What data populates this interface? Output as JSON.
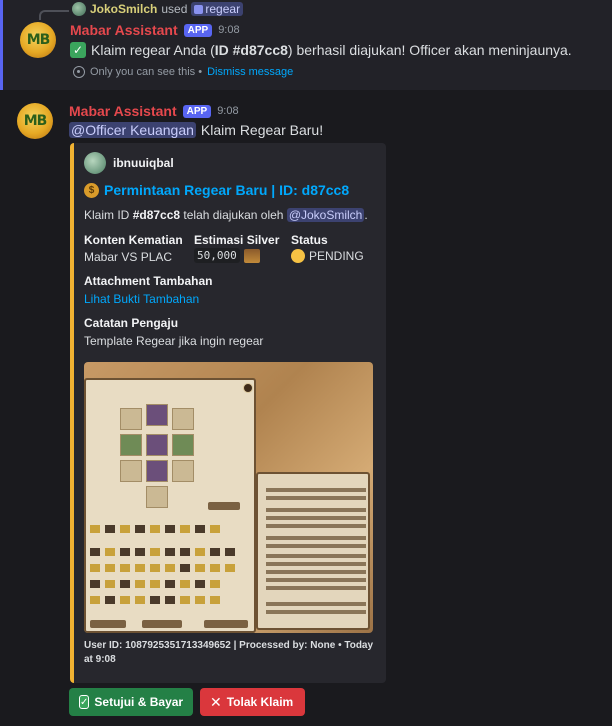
{
  "message1": {
    "reply": {
      "user": "JokoSmilch",
      "used": "used",
      "command": "regear"
    },
    "bot": {
      "name": "Mabar Assistant",
      "badge": "APP",
      "time": "9:08",
      "avatar_text": "MB"
    },
    "text_before": "Klaim regear Anda (",
    "text_id": "ID #d87cc8",
    "text_after": ") berhasil diajukan! Officer akan meninjaunya.",
    "ephemeral_note": "Only you can see this •",
    "dismiss": "Dismiss message"
  },
  "message2": {
    "bot": {
      "name": "Mabar Assistant",
      "badge": "APP",
      "time": "9:08",
      "avatar_text": "MB"
    },
    "mention": "@Officer Keuangan",
    "text": "Klaim Regear Baru!",
    "embed": {
      "color": "#f0b232",
      "author": "ibnuuiqbal",
      "title": "Permintaan Regear Baru | ID: d87cc8",
      "desc_prefix": "Klaim ID ",
      "desc_id": "#d87cc8",
      "desc_mid": " telah diajukan oleh ",
      "desc_mention": "@JokoSmilch",
      "desc_end": ".",
      "fields": [
        {
          "name": "Konten Kematian",
          "value": "Mabar VS PLAC"
        },
        {
          "name": "Estimasi Silver",
          "value": "50,000"
        },
        {
          "name": "Status",
          "value": "PENDING"
        },
        {
          "name": "Attachment Tambahan",
          "value": "Lihat Bukti Tambahan"
        },
        {
          "name": "Catatan Pengaju",
          "value": "Template Regear jika ingin regear"
        }
      ],
      "footer": "User ID: 1087925351713349652 | Processed by: None • Today at 9:08"
    },
    "buttons": {
      "approve": "Setujui & Bayar",
      "reject": "Tolak Klaim"
    }
  },
  "colors": {
    "bot_name": "#e5484d",
    "app_badge": "#5865f2",
    "link": "#00a8fc",
    "approve": "#248046",
    "reject": "#da373c"
  }
}
